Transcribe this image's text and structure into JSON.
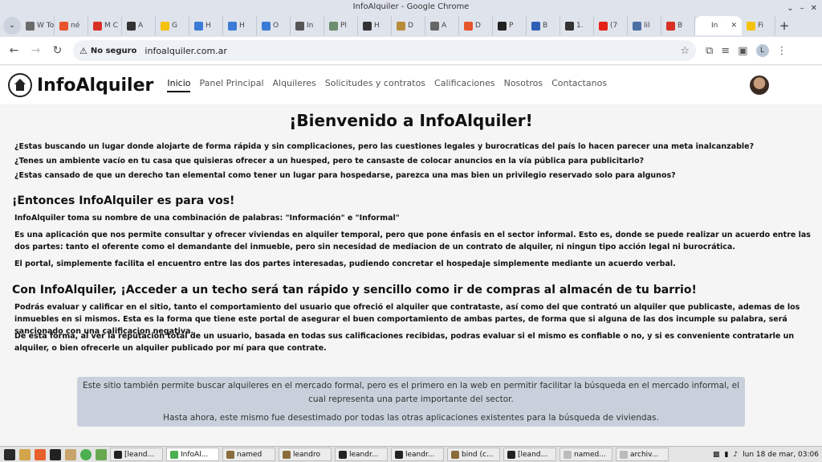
{
  "window": {
    "title": "InfoAlquiler - Google Chrome",
    "controls": [
      "⌄",
      "–",
      "✕"
    ]
  },
  "browser": {
    "tab_list_icon": "chevron-down-icon",
    "tabs": [
      {
        "label": "W To",
        "color": "#6b6b6b"
      },
      {
        "label": "né",
        "color": "#e8542c"
      },
      {
        "label": "M C",
        "color": "#d93025"
      },
      {
        "label": "A",
        "color": "#333333"
      },
      {
        "label": "G",
        "color": "#f4c20d"
      },
      {
        "label": "H",
        "color": "#3a7bd5"
      },
      {
        "label": "H",
        "color": "#3a7bd5"
      },
      {
        "label": "O",
        "color": "#3a7bd5"
      },
      {
        "label": "In",
        "color": "#555555"
      },
      {
        "label": "Pl",
        "color": "#6c8e6c"
      },
      {
        "label": "H",
        "color": "#333333"
      },
      {
        "label": "D",
        "color": "#b88b3a"
      },
      {
        "label": "A",
        "color": "#666666"
      },
      {
        "label": "D",
        "color": "#e8542c"
      },
      {
        "label": "P",
        "color": "#222222"
      },
      {
        "label": "B",
        "color": "#2e5fb5"
      },
      {
        "label": "1.",
        "color": "#333333"
      },
      {
        "label": "(7",
        "color": "#e62117"
      },
      {
        "label": "lil",
        "color": "#4a6fa5"
      },
      {
        "label": "B",
        "color": "#d93025"
      },
      {
        "label": "In",
        "color": "#ffffff",
        "active": true,
        "close": "✕"
      },
      {
        "label": "Fi",
        "color": "#f4c20d"
      }
    ],
    "new_tab": "+",
    "nav": {
      "back": "←",
      "forward": "→",
      "reload": "↻"
    },
    "omnibox": {
      "security_icon": "⚠",
      "security_label": "No seguro",
      "url": "infoalquiler.com.ar",
      "star": "☆"
    },
    "toolbar_icons": [
      "⧉",
      "≡",
      "▣"
    ],
    "profile_initial": "L",
    "menu": "⋮"
  },
  "site": {
    "brand": "InfoAlquiler",
    "nav": [
      "Inicio",
      "Panel Principal",
      "Alquileres",
      "Solicitudes y contratos",
      "Calificaciones",
      "Nosotros",
      "Contactanos"
    ],
    "active_nav": "Inicio"
  },
  "content": {
    "heading": "¡Bienvenido a InfoAlquiler!",
    "questions": [
      "¿Estas buscando un lugar donde alojarte de forma rápida y sin complicaciones, pero las cuestiones legales y burocraticas del país lo hacen parecer una meta inalcanzable?",
      "¿Tenes un ambiente vacío en tu casa que quisieras ofrecer a un huesped, pero te cansaste de colocar anuncios en la vía pública para publicitarlo?",
      "¿Estas cansado de que un derecho tan elemental como tener un lugar para hospedarse, parezca una mas bien un privilegio reservado solo para algunos?"
    ],
    "section1_title": "¡Entonces InfoAlquiler es para vos!",
    "section1_paragraphs": [
      "InfoAlquiler toma su nombre de una combinación de palabras: \"Información\" e \"Informal\"",
      "Es una aplicación que nos permite consultar y ofrecer viviendas en alquiler temporal, pero que pone énfasis en el sector informal. Esto es, donde se puede realizar un acuerdo entre las dos partes: tanto el oferente como el demandante del inmueble, pero sin necesidad de mediacion de un contrato de alquiler, ni ningun tipo acción legal ni burocrática.",
      "El portal, simplemente facilita el encuentro entre las dos partes interesadas, pudiendo concretar el hospedaje simplemente mediante un acuerdo verbal."
    ],
    "section2_title": "Con InfoAlquiler, ¡Acceder a un techo será tan rápido y sencillo como ir de compras al almacén de tu barrio!",
    "section2_paragraphs": [
      "Podrás evaluar y calificar en el sitio, tanto el comportamiento del usuario que ofreció el alquiler que contrataste, así como del que contrató un alquiler que publicaste, ademas de los inmuebles en si mismos. Esta es la forma que tiene este portal de asegurar el buen comportamiento de ambas partes, de forma que si alguna de las dos incumple su palabra, será sancionado con una calificacion negativa.",
      "De esta forma, al ver la reputación total de un usuario, basada en todas sus calificaciones recibidas, podras evaluar si el mismo es confiable o no, y si es conveniente contratarle un alquiler, o bien ofrecerle un alquiler publicado por mí para que contrate."
    ],
    "info_box": [
      "Este sitio también permite buscar alquileres en el mercado formal, pero es el primero en la web en permitir facilitar la búsqueda en el mercado informal, el cual representa una parte importante del sector.",
      "Hasta ahora, este mismo fue desestimado por todas las otras aplicaciones existentes para la búsqueda de viviendas."
    ]
  },
  "taskbar": {
    "tasks": [
      {
        "label": "[leand...",
        "color": "#222222"
      },
      {
        "label": "InfoAl...",
        "color": "#4caf50",
        "active": true
      },
      {
        "label": "named",
        "color": "#8a6d3b"
      },
      {
        "label": "leandro",
        "color": "#8a6d3b"
      },
      {
        "label": "leandr...",
        "color": "#222222"
      },
      {
        "label": "leandr...",
        "color": "#222222"
      },
      {
        "label": "bind (c...",
        "color": "#8a6d3b"
      },
      {
        "label": "[leand...",
        "color": "#222222"
      },
      {
        "label": "named...",
        "color": "#bbbbbb"
      },
      {
        "label": "archiv...",
        "color": "#bbbbbb"
      }
    ],
    "clock": "lun 18 de mar, 03:06"
  }
}
